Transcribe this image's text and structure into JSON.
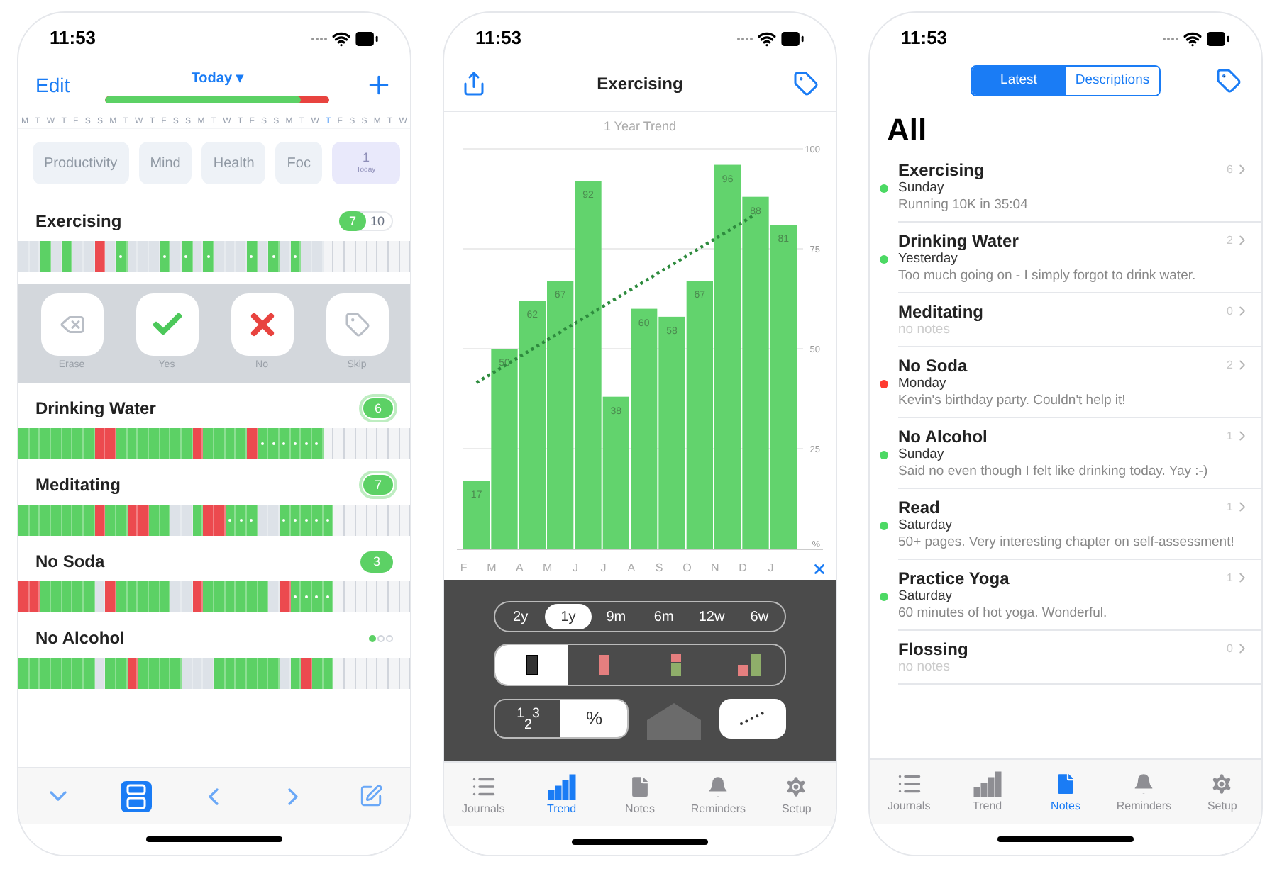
{
  "journals_screen": {
    "status_time": "11:53",
    "edit": "Edit",
    "title": "Today ▾",
    "progress": {
      "level": 0.87
    },
    "week_strip": [
      {
        "letter": "M",
        "selected": false
      },
      {
        "letter": "T",
        "selected": false
      },
      {
        "letter": "W",
        "selected": false
      },
      {
        "letter": "T",
        "selected": false
      },
      {
        "letter": "F",
        "selected": false
      },
      {
        "letter": "S",
        "selected": false
      },
      {
        "letter": "S",
        "selected": false
      },
      {
        "letter": "M",
        "selected": false
      },
      {
        "letter": "T",
        "selected": false
      },
      {
        "letter": "W",
        "selected": false
      },
      {
        "letter": "T",
        "selected": false
      },
      {
        "letter": "F",
        "selected": false
      },
      {
        "letter": "S",
        "selected": false
      },
      {
        "letter": "S",
        "selected": false
      },
      {
        "letter": "M",
        "selected": false
      },
      {
        "letter": "T",
        "selected": false
      },
      {
        "letter": "W",
        "selected": false
      },
      {
        "letter": "T",
        "selected": false
      },
      {
        "letter": "F",
        "selected": false
      },
      {
        "letter": "S",
        "selected": false
      },
      {
        "letter": "S",
        "selected": false
      },
      {
        "letter": "M",
        "selected": false
      },
      {
        "letter": "T",
        "selected": false
      },
      {
        "letter": "W",
        "selected": false
      },
      {
        "letter": "T",
        "selected": true
      },
      {
        "letter": "F",
        "selected": false
      },
      {
        "letter": "S",
        "selected": false
      },
      {
        "letter": "S",
        "selected": false
      },
      {
        "letter": "M",
        "selected": false
      },
      {
        "letter": "T",
        "selected": false
      },
      {
        "letter": "W",
        "selected": false
      }
    ],
    "categories": [
      "Productivity",
      "Mind",
      "Health",
      "Foc"
    ],
    "today_chip": {
      "count": "1",
      "label": "Today"
    },
    "journals": [
      {
        "name": "Exercising",
        "badge": {
          "kind": "pill",
          "value": "7",
          "total": "10"
        },
        "days": [
          {
            "kind": "skip"
          },
          {
            "kind": "skip"
          },
          {
            "kind": "yes"
          },
          {
            "kind": "skip"
          },
          {
            "kind": "yes"
          },
          {
            "kind": "skip"
          },
          {
            "kind": "skip"
          },
          {
            "kind": "no"
          },
          {
            "kind": "skip"
          },
          {
            "kind": "note"
          },
          {
            "kind": "skip"
          },
          {
            "kind": "skip"
          },
          {
            "kind": "skip"
          },
          {
            "kind": "note"
          },
          {
            "kind": "skip"
          },
          {
            "kind": "note"
          },
          {
            "kind": "skip"
          },
          {
            "kind": "note"
          },
          {
            "kind": "skip"
          },
          {
            "kind": "skip"
          },
          {
            "kind": "skip"
          },
          {
            "kind": "note"
          },
          {
            "kind": "skip"
          },
          {
            "kind": "note"
          },
          {
            "kind": "skip"
          },
          {
            "kind": "note"
          },
          {
            "kind": "skip"
          },
          {
            "kind": "skip"
          },
          {
            "kind": "empty"
          },
          {
            "kind": "empty"
          },
          {
            "kind": "empty"
          },
          {
            "kind": "empty"
          },
          {
            "kind": "empty"
          },
          {
            "kind": "empty"
          },
          {
            "kind": "empty"
          },
          {
            "kind": "empty"
          }
        ],
        "actions": [
          "Erase",
          "Yes",
          "No",
          "Skip"
        ]
      },
      {
        "name": "Drinking Water",
        "badge": {
          "kind": "ring",
          "value": "6"
        },
        "days": [
          {
            "kind": "yes"
          },
          {
            "kind": "yes"
          },
          {
            "kind": "yes"
          },
          {
            "kind": "yes"
          },
          {
            "kind": "yes"
          },
          {
            "kind": "yes"
          },
          {
            "kind": "yes"
          },
          {
            "kind": "no"
          },
          {
            "kind": "no"
          },
          {
            "kind": "yes"
          },
          {
            "kind": "yes"
          },
          {
            "kind": "yes"
          },
          {
            "kind": "yes"
          },
          {
            "kind": "yes"
          },
          {
            "kind": "yes"
          },
          {
            "kind": "yes"
          },
          {
            "kind": "no"
          },
          {
            "kind": "yes"
          },
          {
            "kind": "yes"
          },
          {
            "kind": "yes"
          },
          {
            "kind": "yes"
          },
          {
            "kind": "no"
          },
          {
            "kind": "note"
          },
          {
            "kind": "note"
          },
          {
            "kind": "note"
          },
          {
            "kind": "note"
          },
          {
            "kind": "note"
          },
          {
            "kind": "note"
          },
          {
            "kind": "empty"
          },
          {
            "kind": "empty"
          },
          {
            "kind": "empty"
          },
          {
            "kind": "empty"
          },
          {
            "kind": "empty"
          },
          {
            "kind": "empty"
          },
          {
            "kind": "empty"
          },
          {
            "kind": "empty"
          }
        ]
      },
      {
        "name": "Meditating",
        "badge": {
          "kind": "ring",
          "value": "7"
        },
        "days": [
          {
            "kind": "yes"
          },
          {
            "kind": "yes"
          },
          {
            "kind": "yes"
          },
          {
            "kind": "yes"
          },
          {
            "kind": "yes"
          },
          {
            "kind": "yes"
          },
          {
            "kind": "yes"
          },
          {
            "kind": "no"
          },
          {
            "kind": "yes"
          },
          {
            "kind": "yes"
          },
          {
            "kind": "no"
          },
          {
            "kind": "no"
          },
          {
            "kind": "yes"
          },
          {
            "kind": "yes"
          },
          {
            "kind": "skip"
          },
          {
            "kind": "skip"
          },
          {
            "kind": "yes"
          },
          {
            "kind": "no"
          },
          {
            "kind": "no"
          },
          {
            "kind": "note"
          },
          {
            "kind": "note"
          },
          {
            "kind": "note"
          },
          {
            "kind": "skip"
          },
          {
            "kind": "skip"
          },
          {
            "kind": "note"
          },
          {
            "kind": "note"
          },
          {
            "kind": "note"
          },
          {
            "kind": "note"
          },
          {
            "kind": "note"
          },
          {
            "kind": "empty"
          },
          {
            "kind": "empty"
          },
          {
            "kind": "empty"
          },
          {
            "kind": "empty"
          },
          {
            "kind": "empty"
          },
          {
            "kind": "empty"
          },
          {
            "kind": "empty"
          }
        ]
      },
      {
        "name": "No Soda",
        "badge": {
          "kind": "solid",
          "value": "3"
        },
        "days": [
          {
            "kind": "no"
          },
          {
            "kind": "no"
          },
          {
            "kind": "yes"
          },
          {
            "kind": "yes"
          },
          {
            "kind": "yes"
          },
          {
            "kind": "yes"
          },
          {
            "kind": "yes"
          },
          {
            "kind": "skip"
          },
          {
            "kind": "no"
          },
          {
            "kind": "yes"
          },
          {
            "kind": "yes"
          },
          {
            "kind": "yes"
          },
          {
            "kind": "yes"
          },
          {
            "kind": "yes"
          },
          {
            "kind": "skip"
          },
          {
            "kind": "skip"
          },
          {
            "kind": "no"
          },
          {
            "kind": "yes"
          },
          {
            "kind": "yes"
          },
          {
            "kind": "yes"
          },
          {
            "kind": "yes"
          },
          {
            "kind": "yes"
          },
          {
            "kind": "yes"
          },
          {
            "kind": "skip"
          },
          {
            "kind": "no"
          },
          {
            "kind": "note"
          },
          {
            "kind": "note"
          },
          {
            "kind": "note"
          },
          {
            "kind": "note"
          },
          {
            "kind": "empty"
          },
          {
            "kind": "empty"
          },
          {
            "kind": "empty"
          },
          {
            "kind": "empty"
          },
          {
            "kind": "empty"
          },
          {
            "kind": "empty"
          },
          {
            "kind": "empty"
          }
        ]
      },
      {
        "name": "No Alcohol",
        "badge": {
          "kind": "dots",
          "dots": [
            {
              "on": true
            },
            {
              "on": false
            },
            {
              "on": false
            }
          ]
        },
        "days": [
          {
            "kind": "yes"
          },
          {
            "kind": "yes"
          },
          {
            "kind": "yes"
          },
          {
            "kind": "yes"
          },
          {
            "kind": "yes"
          },
          {
            "kind": "yes"
          },
          {
            "kind": "yes"
          },
          {
            "kind": "skip"
          },
          {
            "kind": "yes"
          },
          {
            "kind": "yes"
          },
          {
            "kind": "no"
          },
          {
            "kind": "yes"
          },
          {
            "kind": "yes"
          },
          {
            "kind": "yes"
          },
          {
            "kind": "yes"
          },
          {
            "kind": "skip"
          },
          {
            "kind": "skip"
          },
          {
            "kind": "skip"
          },
          {
            "kind": "yes"
          },
          {
            "kind": "yes"
          },
          {
            "kind": "yes"
          },
          {
            "kind": "yes"
          },
          {
            "kind": "yes"
          },
          {
            "kind": "yes"
          },
          {
            "kind": "skip"
          },
          {
            "kind": "yes"
          },
          {
            "kind": "no"
          },
          {
            "kind": "yes"
          },
          {
            "kind": "yes"
          },
          {
            "kind": "empty"
          },
          {
            "kind": "empty"
          },
          {
            "kind": "empty"
          },
          {
            "kind": "empty"
          },
          {
            "kind": "empty"
          },
          {
            "kind": "empty"
          },
          {
            "kind": "empty"
          }
        ]
      }
    ],
    "toolbar": [
      {
        "selected": false
      },
      {
        "selected": true
      },
      {
        "selected": false
      },
      {
        "selected": false
      },
      {
        "selected": false
      }
    ]
  },
  "trend_screen": {
    "status_time": "11:53",
    "title": "Exercising",
    "chart": {
      "chart_data": {
        "type": "bar",
        "title": "1 Year Trend",
        "ylabel": "%",
        "categories": [
          "F",
          "M",
          "A",
          "M",
          "J",
          "J",
          "A",
          "S",
          "O",
          "N",
          "D",
          "J"
        ],
        "values": [
          17,
          50,
          62,
          67,
          92,
          38,
          60,
          58,
          67,
          96,
          88,
          81
        ],
        "ylim": [
          0,
          100
        ],
        "yticks": [
          25,
          50,
          75,
          100
        ],
        "grid": true,
        "data_labels": true
      }
    },
    "ranges": [
      {
        "label": "2y",
        "selected": false
      },
      {
        "label": "1y",
        "selected": true
      },
      {
        "label": "9m",
        "selected": false
      },
      {
        "label": "6m",
        "selected": false
      },
      {
        "label": "12w",
        "selected": false
      },
      {
        "label": "6w",
        "selected": false
      }
    ],
    "chart_styles": [
      {
        "kind": "plain",
        "selected": true
      },
      {
        "kind": "missed",
        "selected": false
      },
      {
        "kind": "split",
        "selected": false
      },
      {
        "kind": "compare",
        "selected": false
      }
    ],
    "value_format": [
      {
        "label": "$^{1}$$_{2}$$^{3}$",
        "selected": false
      },
      {
        "label": "%",
        "selected": true
      }
    ],
    "toggles": [
      {
        "kind": "area",
        "on": false
      },
      {
        "kind": "trend",
        "on": true
      }
    ],
    "tabs": [
      {
        "label": "Journals",
        "selected": false
      },
      {
        "label": "Trend",
        "selected": true
      },
      {
        "label": "Notes",
        "selected": false
      },
      {
        "label": "Reminders",
        "selected": false
      },
      {
        "label": "Setup",
        "selected": false
      }
    ]
  },
  "notes_screen": {
    "status_time": "11:53",
    "segments": [
      {
        "label": "Latest",
        "selected": true
      },
      {
        "label": "Descriptions",
        "selected": false
      }
    ],
    "heading": "All",
    "notes": [
      {
        "title": "Exercising",
        "count": "6",
        "day": "Sunday",
        "color": "#4cd964",
        "note": "Running 10K in 35:04"
      },
      {
        "title": "Drinking Water",
        "count": "2",
        "day": "Yesterday",
        "color": "#4cd964",
        "note": "Too much going on - I simply forgot to drink water."
      },
      {
        "title": "Meditating",
        "count": "0",
        "note": "no notes"
      },
      {
        "title": "No Soda",
        "count": "2",
        "day": "Monday",
        "color": "#ff3b30",
        "note": "Kevin's birthday party. Couldn't help it!"
      },
      {
        "title": "No Alcohol",
        "count": "1",
        "day": "Sunday",
        "color": "#4cd964",
        "note": "Said no even though I felt like drinking today. Yay :-)"
      },
      {
        "title": "Read",
        "count": "1",
        "day": "Saturday",
        "color": "#4cd964",
        "note": "50+ pages. Very interesting chapter on self-assessment!"
      },
      {
        "title": "Practice Yoga",
        "count": "1",
        "day": "Saturday",
        "color": "#4cd964",
        "note": "60 minutes of hot yoga. Wonderful."
      },
      {
        "title": "Flossing",
        "count": "0",
        "note": "no notes"
      }
    ],
    "tabs": [
      {
        "label": "Journals",
        "selected": false
      },
      {
        "label": "Trend",
        "selected": false
      },
      {
        "label": "Notes",
        "selected": true
      },
      {
        "label": "Reminders",
        "selected": false
      },
      {
        "label": "Setup",
        "selected": false
      }
    ]
  }
}
